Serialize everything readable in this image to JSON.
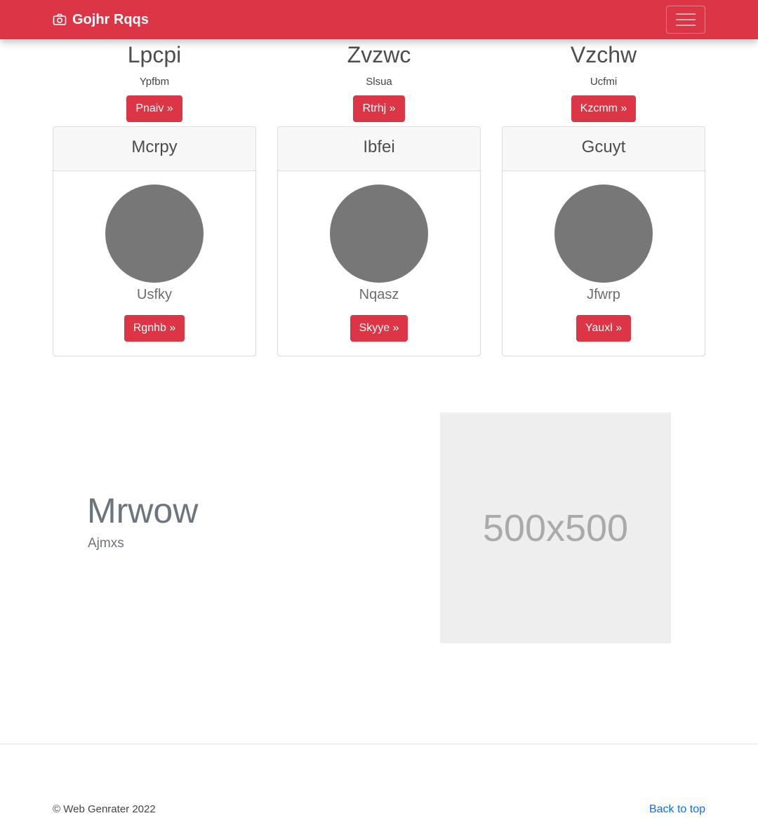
{
  "navbar": {
    "brand_icon": "camera-icon",
    "brand_text": "Gojhr Rqqs",
    "toggler_icon": "hamburger-menu-icon",
    "background": "#dc3545"
  },
  "features": [
    {
      "title": "Lpcpi",
      "text": "Ypfbm",
      "button": "Pnaiv »"
    },
    {
      "title": "Zvzwc",
      "text": "Slsua",
      "button": "Rtrhj »"
    },
    {
      "title": "Vzchw",
      "text": "Ucfmi",
      "button": "Kzcmm »"
    }
  ],
  "cards": [
    {
      "header": "Mcrpy",
      "name": "Usfky",
      "button": "Rgnhb »"
    },
    {
      "header": "Ibfei",
      "name": "Nqasz",
      "button": "Skyye »"
    },
    {
      "header": "Gcuyt",
      "name": "Jfwrp",
      "button": "Yauxl »"
    }
  ],
  "featurette": {
    "heading": "Mrwow",
    "lead": "Ajmxs",
    "image_text": "500x500"
  },
  "footer": {
    "copyright": "© Web Genrater 2022",
    "back_to_top": "Back to top"
  },
  "colors": {
    "accent": "#dc3545",
    "link": "#0d6efd",
    "avatar": "#777777",
    "placeholder": "#eeeeee"
  }
}
